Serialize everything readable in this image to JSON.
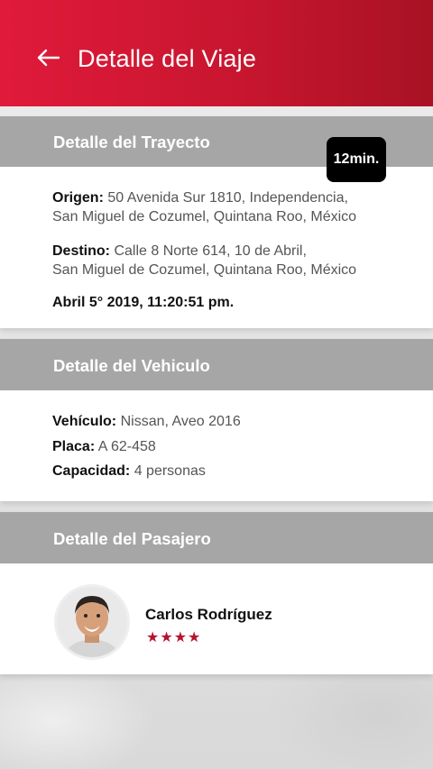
{
  "header": {
    "title": "Detalle del Viaje",
    "back_icon": "arrow-left-icon",
    "color": "#d8183a"
  },
  "trip": {
    "section_title": "Detalle del Trayecto",
    "duration": "12min.",
    "origin_label": "Origen:",
    "origin_line1": "50 Avenida Sur 1810, Independencia,",
    "origin_line2": "San Miguel de Cozumel, Quintana Roo, México",
    "destination_label": "Destino:",
    "destination_line1": "Calle 8 Norte 614, 10 de Abril,",
    "destination_line2": "San Miguel de Cozumel, Quintana Roo, México",
    "datetime": "Abril 5° 2019, 11:20:51 pm."
  },
  "vehicle": {
    "section_title": "Detalle del Vehiculo",
    "vehicle_label": "Vehículo:",
    "vehicle_value": "Nissan, Aveo 2016",
    "plate_label": "Placa:",
    "plate_value": "A 62-458",
    "capacity_label": "Capacidad:",
    "capacity_value": "4 personas"
  },
  "passenger": {
    "section_title": "Detalle del Pasajero",
    "name": "Carlos Rodríguez",
    "rating": 4,
    "rating_max": 4,
    "rating_color": "#b5142e",
    "rating_stars": "★★★★"
  }
}
